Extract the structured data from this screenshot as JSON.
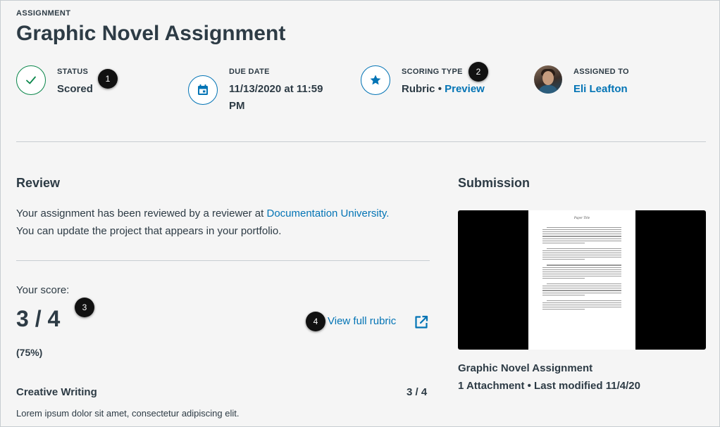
{
  "header": {
    "eyebrow": "ASSIGNMENT",
    "title": "Graphic Novel Assignment"
  },
  "meta": {
    "status": {
      "label": "STATUS",
      "value": "Scored",
      "icon": "check-icon",
      "color": "#0b874b"
    },
    "due": {
      "label": "DUE DATE",
      "value_line1": "11/13/2020 at 11:59",
      "value_line2": "PM",
      "icon": "calendar-icon"
    },
    "scoring": {
      "label": "SCORING TYPE",
      "type": "Rubric",
      "separator": "•",
      "preview_link": "Preview",
      "icon": "star-icon"
    },
    "assigned": {
      "label": "ASSIGNED TO",
      "name": "Eli Leafton"
    }
  },
  "callouts": [
    "1",
    "2",
    "3",
    "4"
  ],
  "review": {
    "heading": "Review",
    "text_before": "Your assignment has been reviewed by a reviewer at ",
    "institution": "Documentation University.",
    "text_after": "You can update the project that appears in your portfolio.",
    "score_label": "Your score:",
    "score": "3 / 4",
    "percent": "(75%)",
    "rubric_link": "View full rubric",
    "criterion": {
      "name": "Creative Writing",
      "score": "3 / 4",
      "description": "Lorem ipsum dolor sit amet, consectetur adipiscing elit."
    }
  },
  "submission": {
    "heading": "Submission",
    "page_title": "Paper Title",
    "title": "Graphic Novel Assignment",
    "meta": "1 Attachment • Last modified 11/4/20"
  },
  "colors": {
    "accent": "#0374b5",
    "success": "#0b874b",
    "text": "#2d3b45"
  }
}
